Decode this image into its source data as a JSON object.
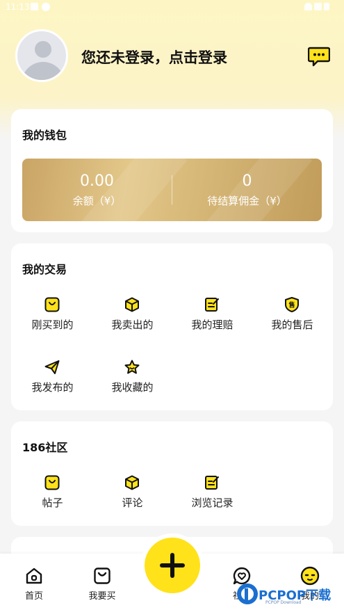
{
  "status_bar": {
    "time": "11:13"
  },
  "header": {
    "login_prompt": "您还未登录，点击登录"
  },
  "wallet": {
    "title": "我的钱包",
    "balance_value": "0.00",
    "balance_label": "余额（¥）",
    "commission_value": "0",
    "commission_label": "待结算佣金（¥）"
  },
  "trades": {
    "title": "我的交易",
    "items": [
      {
        "label": "刚买到的",
        "icon": "shopping-bag-icon"
      },
      {
        "label": "我卖出的",
        "icon": "package-box-icon"
      },
      {
        "label": "我的理赔",
        "icon": "claim-note-icon"
      },
      {
        "label": "我的售后",
        "icon": "after-sale-shield-icon",
        "badge": "售"
      },
      {
        "label": "我发布的",
        "icon": "paper-plane-icon"
      },
      {
        "label": "我收藏的",
        "icon": "star-icon"
      }
    ]
  },
  "community": {
    "title": "186社区",
    "items": [
      {
        "label": "帖子",
        "icon": "shopping-bag-icon"
      },
      {
        "label": "评论",
        "icon": "package-box-icon"
      },
      {
        "label": "浏览记录",
        "icon": "history-note-icon"
      }
    ]
  },
  "tabbar": {
    "items": [
      {
        "label": "首页",
        "icon": "home-icon"
      },
      {
        "label": "我要买",
        "icon": "shopping-bag-icon"
      },
      {
        "label": "社区",
        "icon": "heart-chat-icon"
      },
      {
        "label": "我的",
        "icon": "face-icon"
      }
    ],
    "publish_icon": "plus-icon"
  },
  "watermark": {
    "text": "PCPOP下载",
    "sub": "PCPOP Download"
  },
  "colors": {
    "accent_yellow": "#ffe21a",
    "header_bg": "#fdf6c4",
    "wallet_gold": "#d8ba7a",
    "page_bg": "#f5f5f5"
  }
}
